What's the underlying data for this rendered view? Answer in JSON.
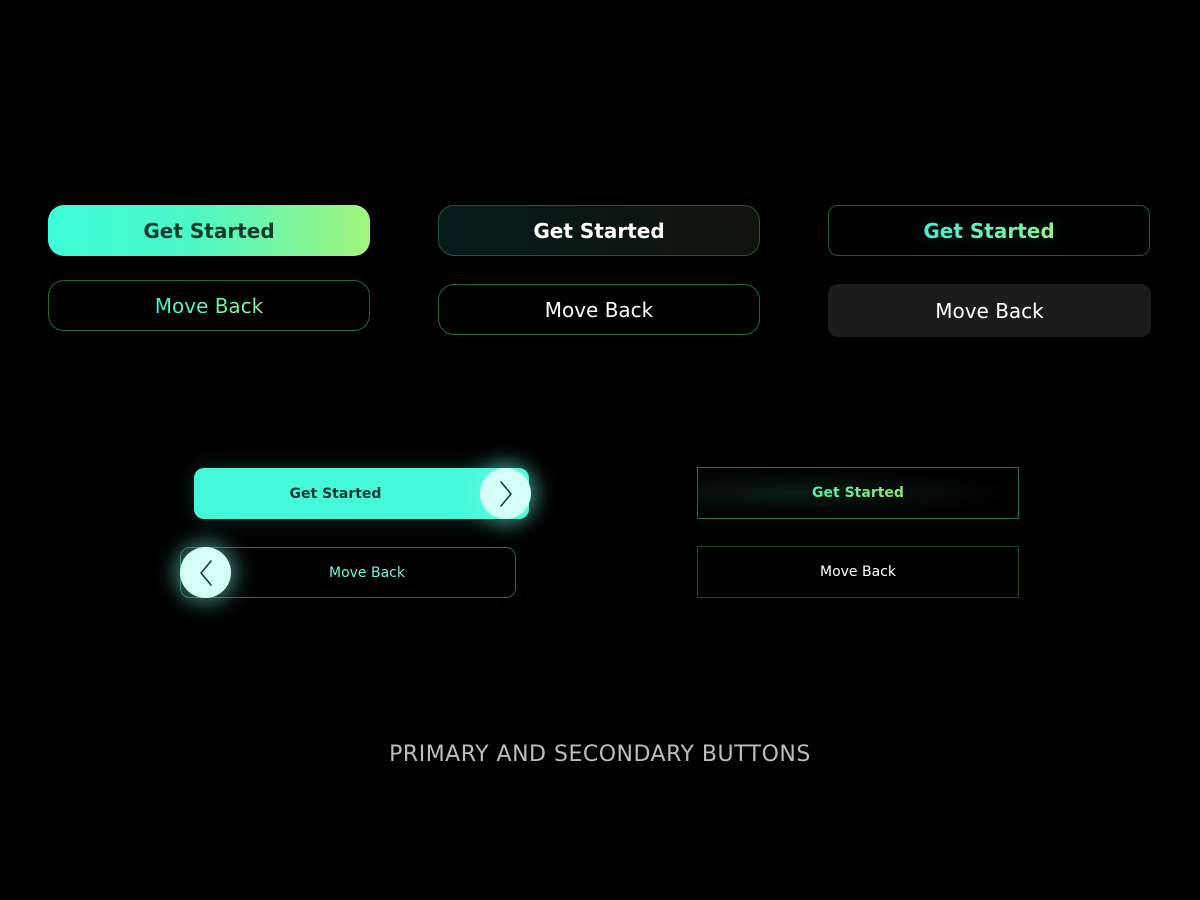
{
  "buttons": {
    "row1": {
      "col1": {
        "primary": "Get Started",
        "secondary": "Move Back"
      },
      "col2": {
        "primary": "Get Started",
        "secondary": "Move Back"
      },
      "col3": {
        "primary": "Get Started",
        "secondary": "Move Back"
      }
    },
    "row2": {
      "left": {
        "primary": "Get Started",
        "secondary": "Move Back"
      },
      "right": {
        "primary": "Get Started",
        "secondary": "Move Back"
      }
    }
  },
  "icons": {
    "next": "chevron-right-icon",
    "back": "chevron-left-icon"
  },
  "caption": "PRIMARY AND SECONDARY BUTTONS",
  "colors": {
    "background": "#000000",
    "accent_cyan": "#46f8da",
    "accent_lime": "#a2f57b",
    "border_green": "#1e6a3a",
    "dark_fill": "#1c1c1c",
    "caption_gray": "#bdbdbd"
  }
}
